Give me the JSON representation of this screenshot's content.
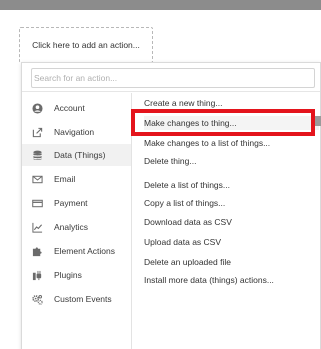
{
  "add_action": {
    "label": "Click here to add an action..."
  },
  "search": {
    "placeholder": "Search for an action..."
  },
  "categories": [
    {
      "label": "Account",
      "icon": "user-circle-icon"
    },
    {
      "label": "Navigation",
      "icon": "external-link-icon"
    },
    {
      "label": "Data (Things)",
      "icon": "database-icon",
      "active": true
    },
    {
      "label": "Email",
      "icon": "envelope-icon"
    },
    {
      "label": "Payment",
      "icon": "credit-card-icon"
    },
    {
      "label": "Analytics",
      "icon": "chart-line-icon"
    },
    {
      "label": "Element Actions",
      "icon": "puzzle-icon"
    },
    {
      "label": "Plugins",
      "icon": "plug-icon"
    },
    {
      "label": "Custom Events",
      "icon": "gears-icon"
    }
  ],
  "actions": [
    {
      "label": "Create a new thing..."
    },
    {
      "label": "Make changes to thing...",
      "highlighted": true
    },
    {
      "label": "Make changes to a list of things..."
    },
    {
      "label": "Delete thing..."
    },
    {
      "label": "Delete a list of things..."
    },
    {
      "label": "Copy a list of things..."
    },
    {
      "label": "Download data as CSV"
    },
    {
      "label": "Upload data as CSV"
    },
    {
      "label": "Delete an uploaded file"
    },
    {
      "label": "Install more data (things) actions..."
    }
  ],
  "colors": {
    "highlight": "#e4141c",
    "top_bar": "#8c8c8c"
  }
}
